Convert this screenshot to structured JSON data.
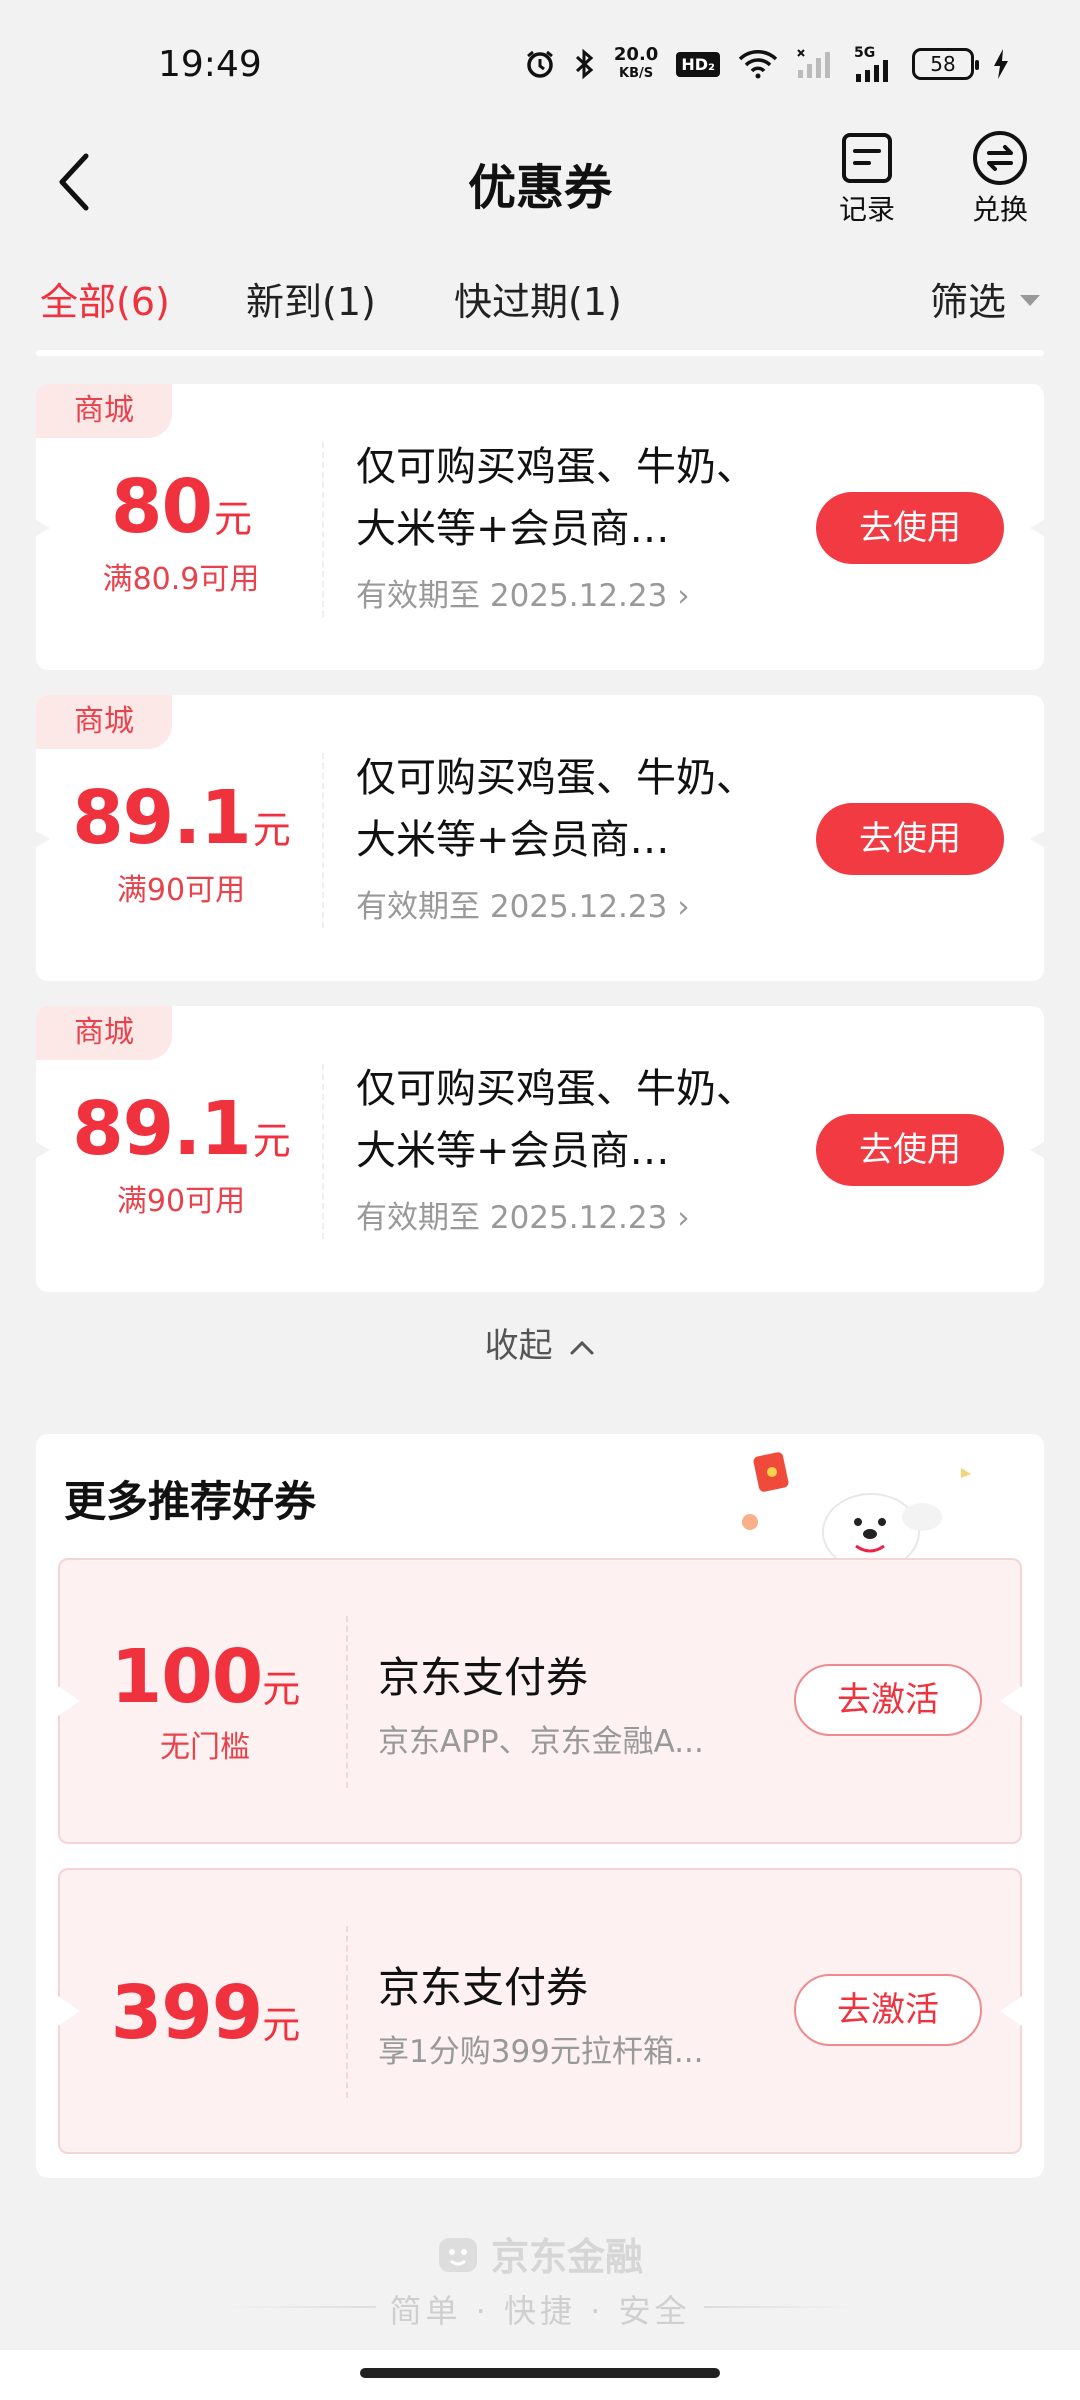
{
  "status_bar": {
    "time": "19:49",
    "net_speed_value": "20.0",
    "net_speed_unit": "KB/S",
    "hd_label": "HD₂",
    "signal_label": "5G",
    "battery": "58"
  },
  "header": {
    "title": "优惠券",
    "record_label": "记录",
    "exchange_label": "兑换"
  },
  "tabs": {
    "all": "全部(6)",
    "new": "新到(1)",
    "expiring": "快过期(1)",
    "filter": "筛选"
  },
  "coupons": [
    {
      "tag": "商城",
      "amount": "80",
      "unit": "元",
      "threshold": "满80.9可用",
      "title": "仅可购买鸡蛋、牛奶、大米等+会员商…",
      "validity": "有效期至 2025.12.23",
      "button": "去使用"
    },
    {
      "tag": "商城",
      "amount": "89.1",
      "unit": "元",
      "threshold": "满90可用",
      "title": "仅可购买鸡蛋、牛奶、大米等+会员商…",
      "validity": "有效期至 2025.12.23",
      "button": "去使用"
    },
    {
      "tag": "商城",
      "amount": "89.1",
      "unit": "元",
      "threshold": "满90可用",
      "title": "仅可购买鸡蛋、牛奶、大米等+会员商…",
      "validity": "有效期至 2025.12.23",
      "button": "去使用"
    }
  ],
  "collapse_label": "收起",
  "recommend": {
    "title": "更多推荐好券",
    "items": [
      {
        "amount": "100",
        "unit": "元",
        "sub": "无门槛",
        "name": "京东支付券",
        "desc": "京东APP、京东金融A...",
        "button": "去激活"
      },
      {
        "amount": "399",
        "unit": "元",
        "sub": "",
        "name": "京东支付券",
        "desc": "享1分购399元拉杆箱...",
        "button": "去激活"
      }
    ]
  },
  "footer": {
    "brand": "京东金融",
    "slogan": "简单 · 快捷 · 安全"
  },
  "colors": {
    "accent": "#f0313e",
    "background": "#f2f2f2",
    "coupon_tag_bg": "#fde8e8",
    "recommend_bg": "#fdf1f1"
  }
}
